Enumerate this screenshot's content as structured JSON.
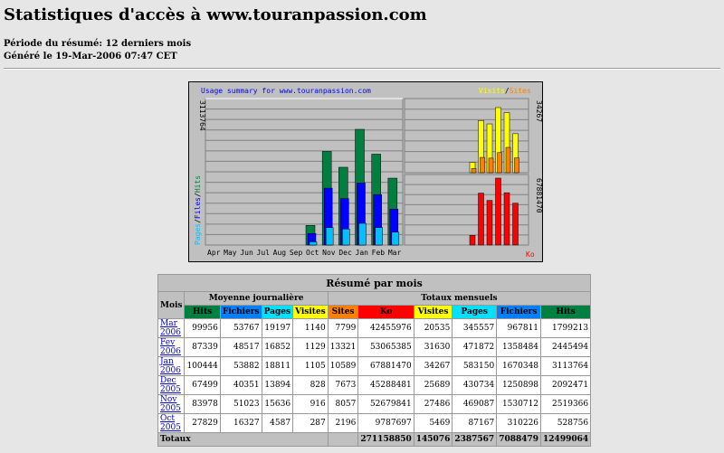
{
  "page": {
    "title": "Statistiques d'accès à www.touranpassion.com",
    "period": "Période du résumé: 12 derniers mois",
    "generated": "Généré le 19-Mar-2006 07:47 CET"
  },
  "chart_data": {
    "type": "bar",
    "title": "Usage summary for www.touranpassion.com",
    "categories": [
      "Apr",
      "May",
      "Jun",
      "Jul",
      "Aug",
      "Sep",
      "Oct",
      "Nov",
      "Dec",
      "Jan",
      "Feb",
      "Mar"
    ],
    "left_axis_label": "Pages / Files / Hits",
    "left_axis_max_label": "3113764",
    "right_top_legend": {
      "visits": "Visits",
      "sep": "/",
      "sites": "Sites"
    },
    "right_top_max_label": "34267",
    "right_bottom_max_label": "67881470",
    "right_bottom_unit": "Ko",
    "left_series": [
      {
        "name": "Hits",
        "color": "#008040",
        "values": [
          0,
          0,
          0,
          0,
          0,
          0,
          528756,
          2519366,
          2092471,
          3113764,
          2445494,
          1799213
        ]
      },
      {
        "name": "Files",
        "color": "#0000ff",
        "values": [
          0,
          0,
          0,
          0,
          0,
          0,
          310226,
          1530712,
          1250898,
          1670348,
          1358484,
          967811
        ]
      },
      {
        "name": "Pages",
        "color": "#00c0ff",
        "values": [
          0,
          0,
          0,
          0,
          0,
          0,
          87167,
          469087,
          430734,
          583150,
          471872,
          345557
        ]
      }
    ],
    "right_top_series": [
      {
        "name": "Visits",
        "color": "#ffff00",
        "values": [
          5469,
          27486,
          25689,
          34267,
          31630,
          20535
        ]
      },
      {
        "name": "Sites",
        "color": "#ff8000",
        "values": [
          2196,
          8057,
          7673,
          10589,
          13321,
          7799
        ]
      }
    ],
    "right_bottom_series": [
      {
        "name": "Ko",
        "color": "#ff0000",
        "values": [
          9787697,
          52679841,
          45288481,
          67881470,
          53065385,
          42455976
        ]
      }
    ]
  },
  "table": {
    "caption": "Résumé par mois",
    "mois_label": "Mois",
    "daily_label": "Moyenne journalière",
    "monthly_label": "Totaux mensuels",
    "daily_cols": [
      {
        "label": "Hits",
        "bg": "#008040",
        "fg": "#000"
      },
      {
        "label": "Fichiers",
        "bg": "#0080ff",
        "fg": "#000"
      },
      {
        "label": "Pages",
        "bg": "#00e0ff",
        "fg": "#000"
      },
      {
        "label": "Visites",
        "bg": "#ffff00",
        "fg": "#000"
      }
    ],
    "monthly_cols": [
      {
        "label": "Sites",
        "bg": "#ff8000",
        "fg": "#000"
      },
      {
        "label": "Ko",
        "bg": "#ff0000",
        "fg": "#000"
      },
      {
        "label": "Visites",
        "bg": "#ffff00",
        "fg": "#000"
      },
      {
        "label": "Pages",
        "bg": "#00e0ff",
        "fg": "#000"
      },
      {
        "label": "Fichiers",
        "bg": "#0080ff",
        "fg": "#000"
      },
      {
        "label": "Hits",
        "bg": "#008040",
        "fg": "#000"
      }
    ],
    "rows": [
      {
        "month": "Mar 2006",
        "vals": [
          "99956",
          "53767",
          "19197",
          "1140",
          "7799",
          "42455976",
          "20535",
          "345557",
          "967811",
          "1799213"
        ]
      },
      {
        "month": "Fev 2006",
        "vals": [
          "87339",
          "48517",
          "16852",
          "1129",
          "13321",
          "53065385",
          "31630",
          "471872",
          "1358484",
          "2445494"
        ]
      },
      {
        "month": "Jan 2006",
        "vals": [
          "100444",
          "53882",
          "18811",
          "1105",
          "10589",
          "67881470",
          "34267",
          "583150",
          "1670348",
          "3113764"
        ]
      },
      {
        "month": "Dec 2005",
        "vals": [
          "67499",
          "40351",
          "13894",
          "828",
          "7673",
          "45288481",
          "25689",
          "430734",
          "1250898",
          "2092471"
        ]
      },
      {
        "month": "Nov 2005",
        "vals": [
          "83978",
          "51023",
          "15636",
          "916",
          "8057",
          "52679841",
          "27486",
          "469087",
          "1530712",
          "2519366"
        ]
      },
      {
        "month": "Oct 2005",
        "vals": [
          "27829",
          "16327",
          "4587",
          "287",
          "2196",
          "9787697",
          "5469",
          "87167",
          "310226",
          "528756"
        ]
      }
    ],
    "totals_label": "Totaux",
    "totals": [
      "271158850",
      "145076",
      "2387567",
      "7088479",
      "12499064"
    ]
  }
}
